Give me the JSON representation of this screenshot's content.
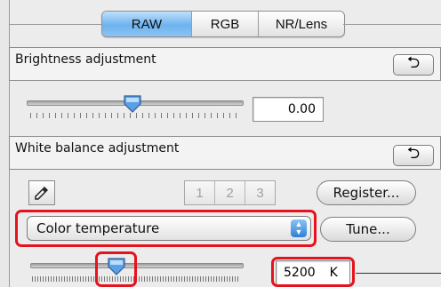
{
  "tabs": [
    {
      "label": "RAW",
      "active": true
    },
    {
      "label": "RGB",
      "active": false
    },
    {
      "label": "NR/Lens",
      "active": false
    }
  ],
  "brightness": {
    "title": "Brightness adjustment",
    "reset_icon": "reset-arrow-icon",
    "reset_glyph": "⮌",
    "value": "0.00"
  },
  "white_balance": {
    "title": "White balance adjustment",
    "reset_icon": "reset-arrow-icon",
    "reset_glyph": "⮌",
    "eyedropper_icon": "eyedropper-icon",
    "presets": [
      "1",
      "2",
      "3"
    ],
    "register_label": "Register...",
    "select_value": "Color temperature",
    "tune_label": "Tune...",
    "temperature_value": "5200",
    "temperature_unit": "K"
  },
  "colors": {
    "active_tab": "#6db2ee",
    "highlight": "#e5131d",
    "thumb": "#4a90e2"
  }
}
